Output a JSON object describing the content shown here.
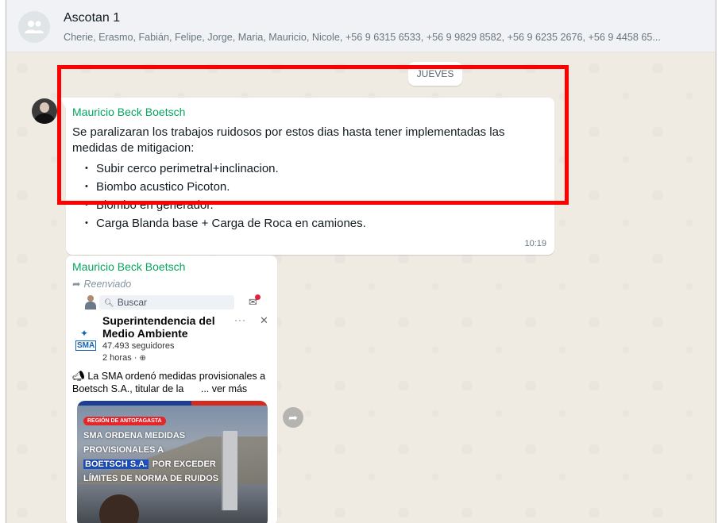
{
  "header": {
    "title": "Ascotan 1",
    "members": "Cherie, Erasmo, Fabián, Felipe, Jorge, Maria, Mauricio, Nicole, +56 9 6315 6533, +56 9 9829 8582, +56 9 6235 2676, +56 9 4458 65..."
  },
  "date_separator": "JUEVES",
  "message_1": {
    "sender": "Mauricio Beck Boetsch",
    "text_line": "Se paralizaran los trabajos ruidosos por estos dias hasta tener implementadas las medidas de mitigacion:",
    "items": [
      "Subir cerco perimetral+inclinacion.",
      "Biombo acustico Picoton.",
      "Biombo en generador.",
      "Carga Blanda base + Carga de Roca en camiones."
    ],
    "time": "10:19",
    "highlight_color": "#ff0000"
  },
  "message_2": {
    "sender": "Mauricio Beck Boetsch",
    "forwarded_label": "Reenviado",
    "embed": {
      "search_label": "Buscar",
      "page_logo_text": "SMA",
      "page_name": "Superintendencia del Medio Ambiente",
      "followers": "47.493 seguidores",
      "post_time": "2 horas ·",
      "post_text": "La SMA ordenó medidas provisionales a Boetsch S.A., titular de la",
      "see_more": "... ver más",
      "card": {
        "region": "REGIÓN DE ANTOFAGASTA",
        "headline_1": "SMA ORDENA MEDIDAS",
        "headline_2": "PROVISIONALES A",
        "headline_3": "BOETSCH S.A.",
        "headline_4": "POR EXCEDER",
        "headline_5": "LÍMITES DE NORMA DE RUIDOS"
      }
    }
  },
  "colors": {
    "chat_background": "#efeae2",
    "sender_name": "#06a55e",
    "bubble": "#ffffff"
  },
  "icons": [
    "group-avatar-icon",
    "forward-arrow-icon",
    "search-icon",
    "messenger-icon",
    "globe-icon",
    "forward-button-icon"
  ]
}
